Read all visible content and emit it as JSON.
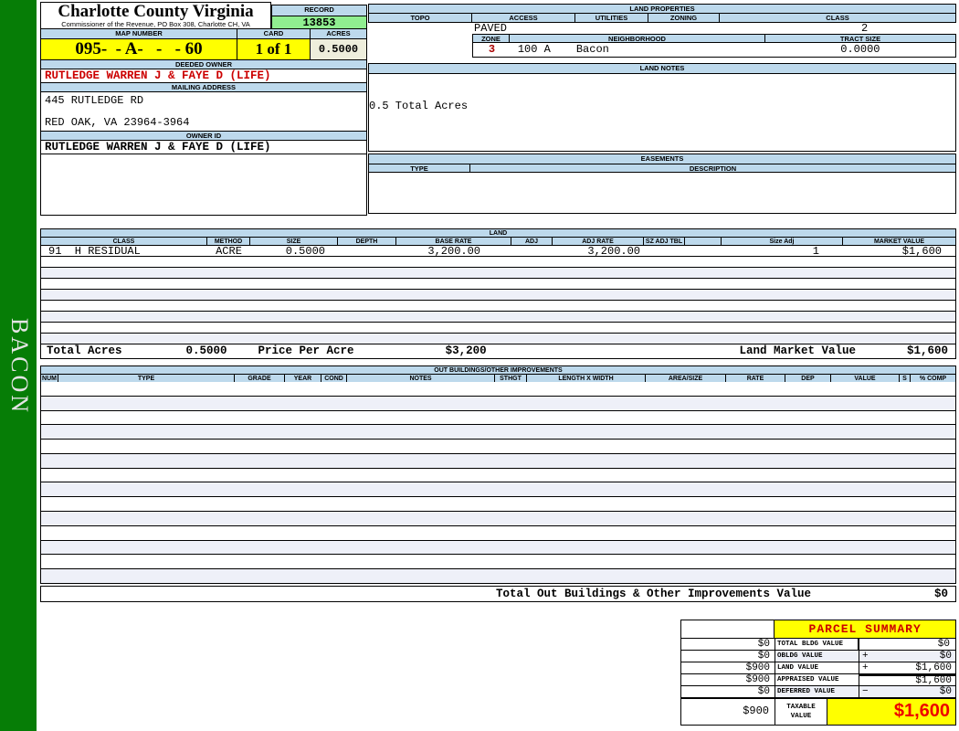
{
  "sidebar": {
    "label": "BACON"
  },
  "header": {
    "county": "Charlotte County Virginia",
    "commissioner": "Commissioner of the Revenue, PO Box 308, Charlotte CH, VA",
    "record_label": "RECORD",
    "record_value": "13853",
    "map_number_label": "MAP NUMBER",
    "map_number_value": "095-  - A-   -   - 60",
    "card_label": "CARD",
    "card_value": "1 of 1",
    "acres_label": "ACRES",
    "acres_value": "0.5000"
  },
  "owner": {
    "deeded_owner_label": "DEEDED OWNER",
    "deeded_owner": "RUTLEDGE WARREN J & FAYE D (LIFE)",
    "mailing_address_label": "MAILING ADDRESS",
    "address_line1": "445 RUTLEDGE RD",
    "address_line2": "RED OAK, VA 23964-3964",
    "owner_id_label": "OWNER ID",
    "owner_id": "RUTLEDGE WARREN J & FAYE D (LIFE)"
  },
  "land_properties": {
    "title": "LAND PROPERTIES",
    "topo_label": "TOPO",
    "access_label": "ACCESS",
    "utilities_label": "UTILITIES",
    "zoning_label": "ZONING",
    "class_label": "CLASS",
    "access_value": "PAVED",
    "class_value": "2",
    "zone_label": "ZONE",
    "zone_value": "3",
    "neighborhood_label": "NEIGHBORHOOD",
    "neighborhood_code": "100 A",
    "neighborhood_name": "Bacon",
    "tract_size_label": "TRACT SIZE",
    "tract_size_value": "0.0000"
  },
  "land_notes": {
    "title": "LAND NOTES",
    "note": "0.5 Total Acres"
  },
  "easements": {
    "title": "EASEMENTS",
    "type_label": "TYPE",
    "description_label": "DESCRIPTION"
  },
  "land_table": {
    "title": "LAND",
    "headers": [
      "CLASS",
      "METHOD",
      "SIZE",
      "DEPTH",
      "BASE RATE",
      "ADJ",
      "ADJ RATE",
      "SZ ADJ TBL",
      "",
      "Size Adj",
      "MARKET VALUE"
    ],
    "rows": [
      {
        "class": "91  H RESIDUAL",
        "method": "ACRE",
        "size": "0.5000",
        "depth": "",
        "base_rate": "3,200.00",
        "adj": "",
        "adj_rate": "3,200.00",
        "sz_adj_tbl": "",
        "blank": "",
        "size_adj": "1",
        "market_value": "$1,600"
      }
    ],
    "total_acres_label": "Total Acres",
    "total_acres": "0.5000",
    "price_per_acre_label": "Price Per Acre",
    "price_per_acre": "$3,200",
    "land_market_value_label": "Land Market Value",
    "land_market_value": "$1,600"
  },
  "out_buildings": {
    "title": "OUT BUILDINGS/OTHER IMPROVEMENTS",
    "headers": [
      "NUM",
      "TYPE",
      "GRADE",
      "YEAR",
      "COND",
      "NOTES",
      "STHGT",
      "LENGTH X WIDTH",
      "AREA/SIZE",
      "RATE",
      "DEP",
      "VALUE",
      "S",
      "% COMP"
    ],
    "total_label": "Total Out Buildings & Other Improvements Value",
    "total_value": "$0"
  },
  "parcel_summary": {
    "title": "PARCEL SUMMARY",
    "rows": [
      {
        "prior": "$0",
        "label": "TOTAL BLDG VALUE",
        "op": "",
        "value": "$0"
      },
      {
        "prior": "$0",
        "label": "OBLDG VALUE",
        "op": "+",
        "value": "$0"
      },
      {
        "prior": "$900",
        "label": "LAND VALUE",
        "op": "+",
        "value": "$1,600"
      },
      {
        "prior": "$900",
        "label": "APPRAISED VALUE",
        "op": "",
        "value": "$1,600"
      },
      {
        "prior": "$0",
        "label": "DEFERRED VALUE",
        "op": "−",
        "value": "$0"
      }
    ],
    "taxable": {
      "prior": "$900",
      "label": "TAXABLE VALUE",
      "value": "$1,600"
    }
  },
  "colors": {
    "sidebar_green": "#067D06",
    "header_blue": "#BDD9EC",
    "field_yellow": "#FFFF00",
    "record_green": "#90EE90",
    "acres_beige": "#EEEEDC",
    "stripe_lavender": "#EEF0F8",
    "alert_red": "#CC0000"
  }
}
